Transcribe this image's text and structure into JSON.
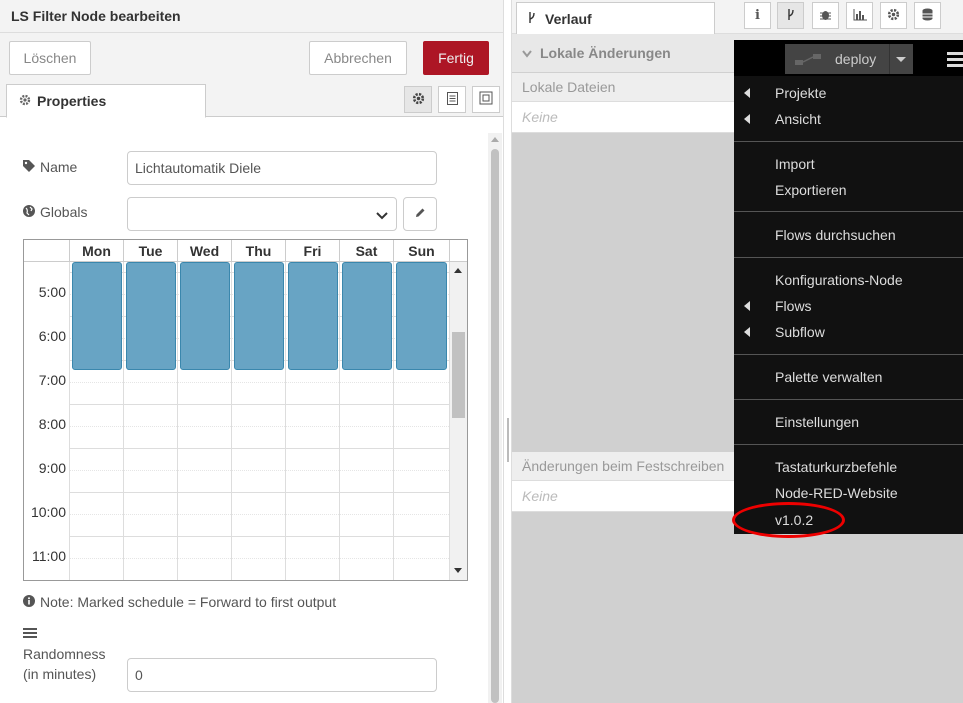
{
  "tray": {
    "title": "LS Filter Node bearbeiten",
    "delete_label": "Löschen",
    "cancel_label": "Abbrechen",
    "done_label": "Fertig",
    "tab_label": "Properties",
    "icons": [
      "gear-icon",
      "file-text-icon",
      "resize-frame-icon"
    ]
  },
  "form": {
    "name_label": "Name",
    "name_value": "Lichtautomatik Diele",
    "globals_label": "Globals",
    "globals_value": "",
    "note": "Note: Marked schedule = Forward to first output",
    "randomness_label_line1": "Randomness",
    "randomness_label_line2": "(in minutes)",
    "randomness_value": "0"
  },
  "calendar": {
    "days": [
      "Mon",
      "Tue",
      "Wed",
      "Thu",
      "Fri",
      "Sat",
      "Sun"
    ],
    "times": [
      "5:00",
      "6:00",
      "7:00",
      "8:00",
      "9:00",
      "10:00",
      "11:00"
    ],
    "event_color": "#68a4c4"
  },
  "sidebar": {
    "tab_label": "Verlauf",
    "icons": [
      "info-icon",
      "branch-icon",
      "bug-icon",
      "chart-icon",
      "gear-icon",
      "database-icon"
    ],
    "section_title": "Lokale Änderungen",
    "local_files_label": "Lokale Dateien",
    "local_files_empty": "Keine",
    "commit_label": "Änderungen beim Festschreiben",
    "commit_empty": "Keine"
  },
  "header": {
    "deploy_label": "deploy"
  },
  "menu": {
    "items": [
      {
        "label": "Projekte",
        "submenu": true
      },
      {
        "label": "Ansicht",
        "submenu": true
      },
      {
        "label": "Import",
        "submenu": false
      },
      {
        "label": "Exportieren",
        "submenu": false
      },
      {
        "label": "Flows durchsuchen",
        "submenu": false
      },
      {
        "label": "Konfigurations-Node",
        "submenu": false
      },
      {
        "label": "Flows",
        "submenu": true
      },
      {
        "label": "Subflow",
        "submenu": true
      },
      {
        "label": "Palette verwalten",
        "submenu": false
      },
      {
        "label": "Einstellungen",
        "submenu": false
      },
      {
        "label": "Tastaturkurzbefehle",
        "submenu": false
      },
      {
        "label": "Node-RED-Website",
        "submenu": false
      },
      {
        "label": "v1.0.2",
        "submenu": false
      }
    ]
  },
  "colors": {
    "primary": "#ad1625",
    "menu_bg": "#111111",
    "highlight": "#ee0000"
  }
}
